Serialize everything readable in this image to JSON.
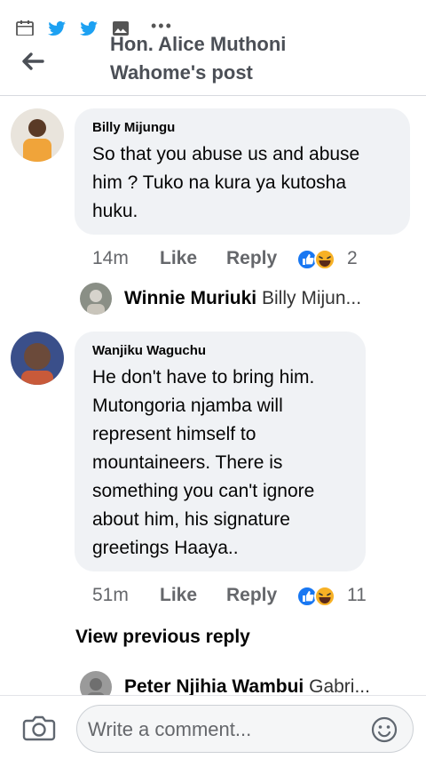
{
  "header": {
    "title_line1": "Hon. Alice Muthoni",
    "title_line2": "Wahome's post"
  },
  "comments": [
    {
      "author": "Billy Mijungu",
      "text": "So that you abuse us and abuse him ? Tuko na kura ya kutosha huku.",
      "time": "14m",
      "like_label": "Like",
      "reply_label": "Reply",
      "reaction_count": "2",
      "reactions": [
        "like-reaction",
        "haha-reaction"
      ],
      "reply_preview": {
        "name": "Winnie Muriuki",
        "text": "Billy Mijun..."
      }
    },
    {
      "author": "Wanjiku Waguchu",
      "text": "He don't have to bring him. Mutongoria njamba will represent himself to mountaineers. There is something you can't ignore about him, his signature greetings Haaya..",
      "time": "51m",
      "like_label": "Like",
      "reply_label": "Reply",
      "reaction_count": "11",
      "reactions": [
        "like-reaction",
        "haha-reaction"
      ],
      "view_previous": "View previous reply",
      "reply_preview": {
        "name": "Peter Njihia Wambui",
        "text": "Gabri..."
      }
    }
  ],
  "composer": {
    "placeholder": "Write a comment..."
  },
  "colors": {
    "facebook_blue": "#1877f2",
    "twitter_blue": "#1da1f2",
    "bubble_bg": "#f0f2f5",
    "haha_yellow": "#f7b125"
  }
}
